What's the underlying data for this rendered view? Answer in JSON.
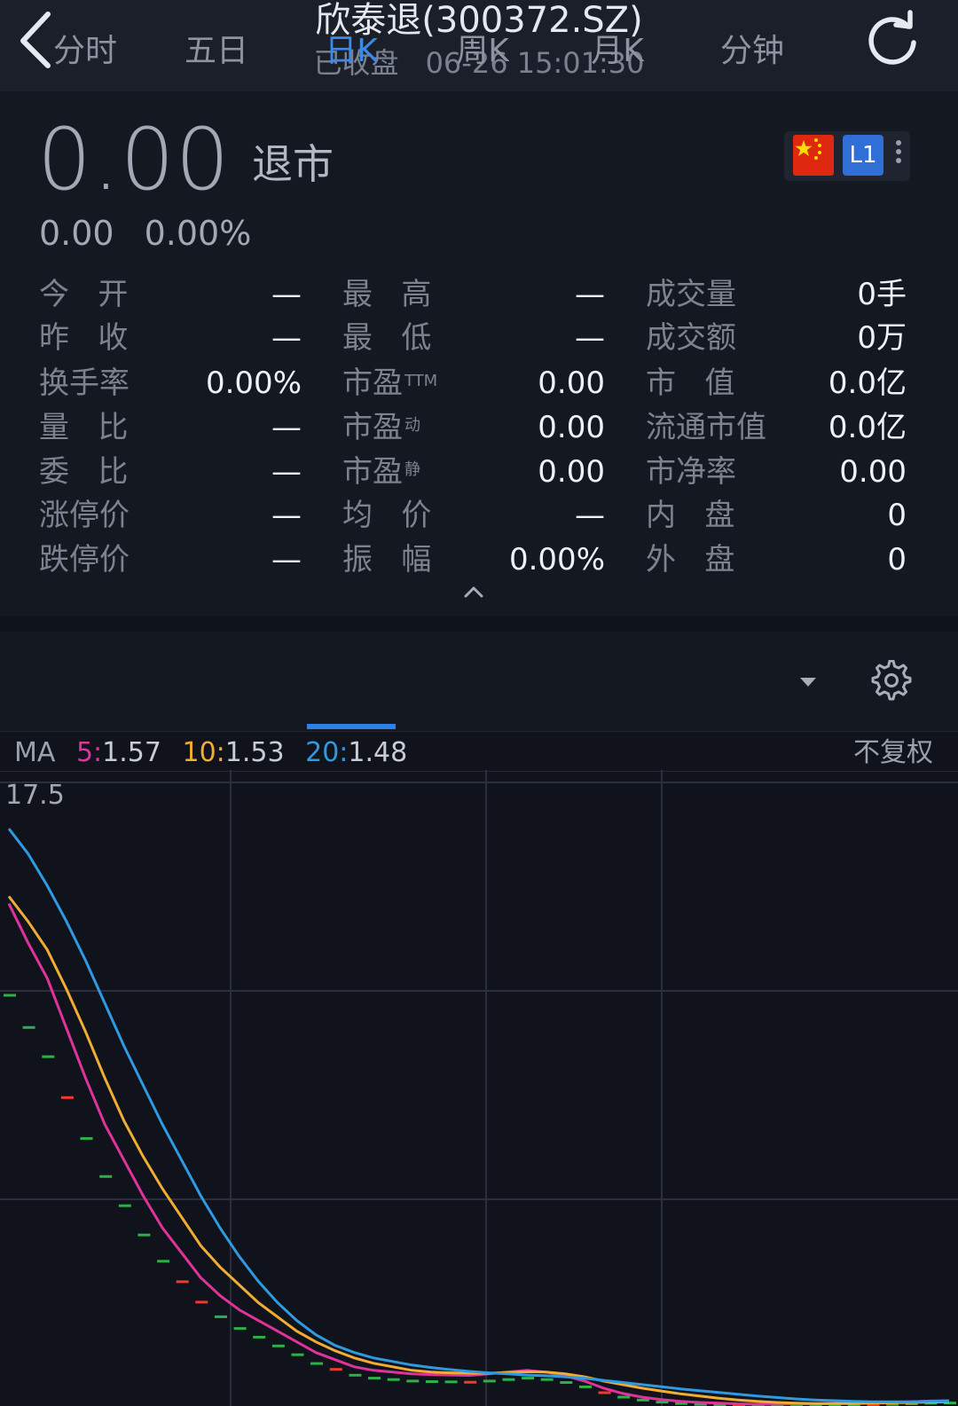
{
  "header": {
    "title": "欣泰退(300372.SZ)",
    "status": "已收盘",
    "datetime": "06-26 15:01:30"
  },
  "quote": {
    "price": "0.00",
    "status_label": "退市",
    "change": "0.00",
    "change_pct": "0.00%",
    "level_badge": "L1"
  },
  "stats": {
    "col1": [
      {
        "label": "今   开",
        "value": "—"
      },
      {
        "label": "昨   收",
        "value": "—"
      },
      {
        "label": "换手率",
        "value": "0.00%"
      },
      {
        "label": "量   比",
        "value": "—"
      },
      {
        "label": "委   比",
        "value": "—"
      },
      {
        "label": "涨停价",
        "value": "—"
      },
      {
        "label": "跌停价",
        "value": "—"
      }
    ],
    "col2": [
      {
        "label": "最   高",
        "sup": "",
        "value": "—"
      },
      {
        "label": "最   低",
        "sup": "",
        "value": "—"
      },
      {
        "label": "市盈",
        "sup": "TTM",
        "value": "0.00"
      },
      {
        "label": "市盈",
        "sup": "动",
        "value": "0.00"
      },
      {
        "label": "市盈",
        "sup": "静",
        "value": "0.00"
      },
      {
        "label": "均   价",
        "sup": "",
        "value": "—"
      },
      {
        "label": "振   幅",
        "sup": "",
        "value": "0.00%"
      }
    ],
    "col3": [
      {
        "label": "成交量",
        "value": "0手"
      },
      {
        "label": "成交额",
        "value": "0万"
      },
      {
        "label": "市   值",
        "value": "0.0亿"
      },
      {
        "label": "流通市值",
        "value": "0.0亿"
      },
      {
        "label": "市净率",
        "value": "0.00"
      },
      {
        "label": "内   盘",
        "value": "0"
      },
      {
        "label": "外   盘",
        "value": "0"
      }
    ]
  },
  "tabs": [
    {
      "label": "分时"
    },
    {
      "label": "五日"
    },
    {
      "label": "日K"
    },
    {
      "label": "周K"
    },
    {
      "label": "月K"
    },
    {
      "label": "分钟"
    }
  ],
  "active_tab": "日K",
  "ma": {
    "label": "MA",
    "ma5_key": "5:",
    "ma5": "1.57",
    "ma10_key": "10:",
    "ma10": "1.53",
    "ma20_key": "20:",
    "ma20": "1.48",
    "adjust": "不复权"
  },
  "colors": {
    "ma5": "#e0339a",
    "ma10": "#f0ad32",
    "ma20": "#2e9ae2",
    "up": "#f03a2e",
    "down": "#2bb04a",
    "active": "#2f80e6"
  },
  "chart_data": {
    "type": "line",
    "top_label": "17.5",
    "ylim": [
      0,
      17.5
    ],
    "x": [
      0,
      1,
      2,
      3,
      4,
      5,
      6,
      7,
      8,
      9,
      10,
      11,
      12,
      13,
      14,
      15,
      16,
      17,
      18,
      19,
      20,
      21,
      22,
      23,
      24,
      25,
      26,
      27,
      28,
      29,
      30,
      31,
      32,
      33,
      34,
      35,
      36,
      37,
      38,
      39,
      40,
      41,
      42,
      43,
      44,
      45,
      46,
      47,
      48,
      49
    ],
    "series": [
      {
        "name": "5",
        "values": [
          14.1,
          13.0,
          12.0,
          10.6,
          9.2,
          7.9,
          6.9,
          5.9,
          5.0,
          4.3,
          3.6,
          3.1,
          2.7,
          2.4,
          2.1,
          1.8,
          1.5,
          1.3,
          1.1,
          1.0,
          0.95,
          0.9,
          0.88,
          0.87,
          0.86,
          0.9,
          0.95,
          1.0,
          0.95,
          0.85,
          0.7,
          0.5,
          0.35,
          0.25,
          0.18,
          0.13,
          0.1,
          0.08,
          0.06,
          0.05,
          0.05,
          0.06,
          0.06,
          0.07,
          0.08,
          0.09,
          0.1,
          0.12,
          0.14,
          0.15
        ]
      },
      {
        "name": "10",
        "values": [
          14.3,
          13.6,
          12.8,
          11.7,
          10.5,
          9.2,
          8.0,
          7.0,
          6.1,
          5.3,
          4.5,
          3.9,
          3.4,
          2.9,
          2.5,
          2.1,
          1.8,
          1.55,
          1.35,
          1.2,
          1.1,
          1.0,
          0.95,
          0.93,
          0.92,
          0.92,
          0.94,
          0.96,
          0.95,
          0.9,
          0.82,
          0.7,
          0.6,
          0.5,
          0.42,
          0.34,
          0.28,
          0.22,
          0.17,
          0.13,
          0.1,
          0.08,
          0.07,
          0.07,
          0.07,
          0.08,
          0.09,
          0.1,
          0.11,
          0.12
        ]
      },
      {
        "name": "20",
        "values": [
          16.2,
          15.5,
          14.6,
          13.6,
          12.5,
          11.3,
          10.1,
          9.0,
          7.9,
          6.9,
          5.9,
          5.0,
          4.2,
          3.5,
          2.9,
          2.4,
          2.0,
          1.7,
          1.5,
          1.35,
          1.25,
          1.15,
          1.08,
          1.02,
          0.97,
          0.93,
          0.9,
          0.87,
          0.85,
          0.82,
          0.78,
          0.72,
          0.66,
          0.6,
          0.54,
          0.48,
          0.43,
          0.38,
          0.33,
          0.28,
          0.24,
          0.2,
          0.17,
          0.15,
          0.13,
          0.12,
          0.12,
          0.12,
          0.13,
          0.14
        ]
      }
    ]
  }
}
